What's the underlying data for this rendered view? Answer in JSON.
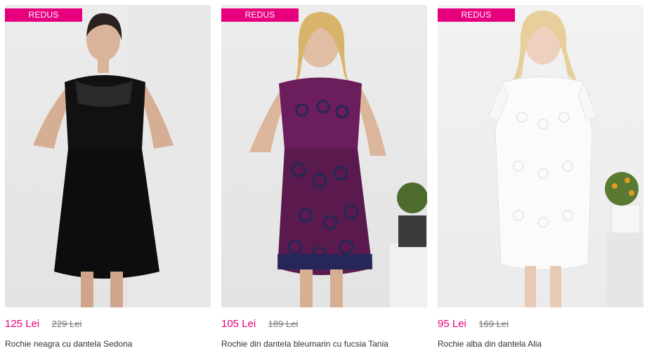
{
  "colors": {
    "accent": "#e6007e",
    "badge_text": "#ffffff",
    "old_price": "#777777",
    "title": "#333333"
  },
  "products": [
    {
      "badge": "REDUS",
      "price_new": "125 Lei",
      "price_old": "229 Lei",
      "title": "Rochie neagra cu dantela Sedona"
    },
    {
      "badge": "REDUS",
      "price_new": "105 Lei",
      "price_old": "189 Lei",
      "title": "Rochie din dantela bleumarin cu fucsia Tania"
    },
    {
      "badge": "REDUS",
      "price_new": "95 Lei",
      "price_old": "169 Lei",
      "title": "Rochie alba din dantela Alia"
    }
  ]
}
